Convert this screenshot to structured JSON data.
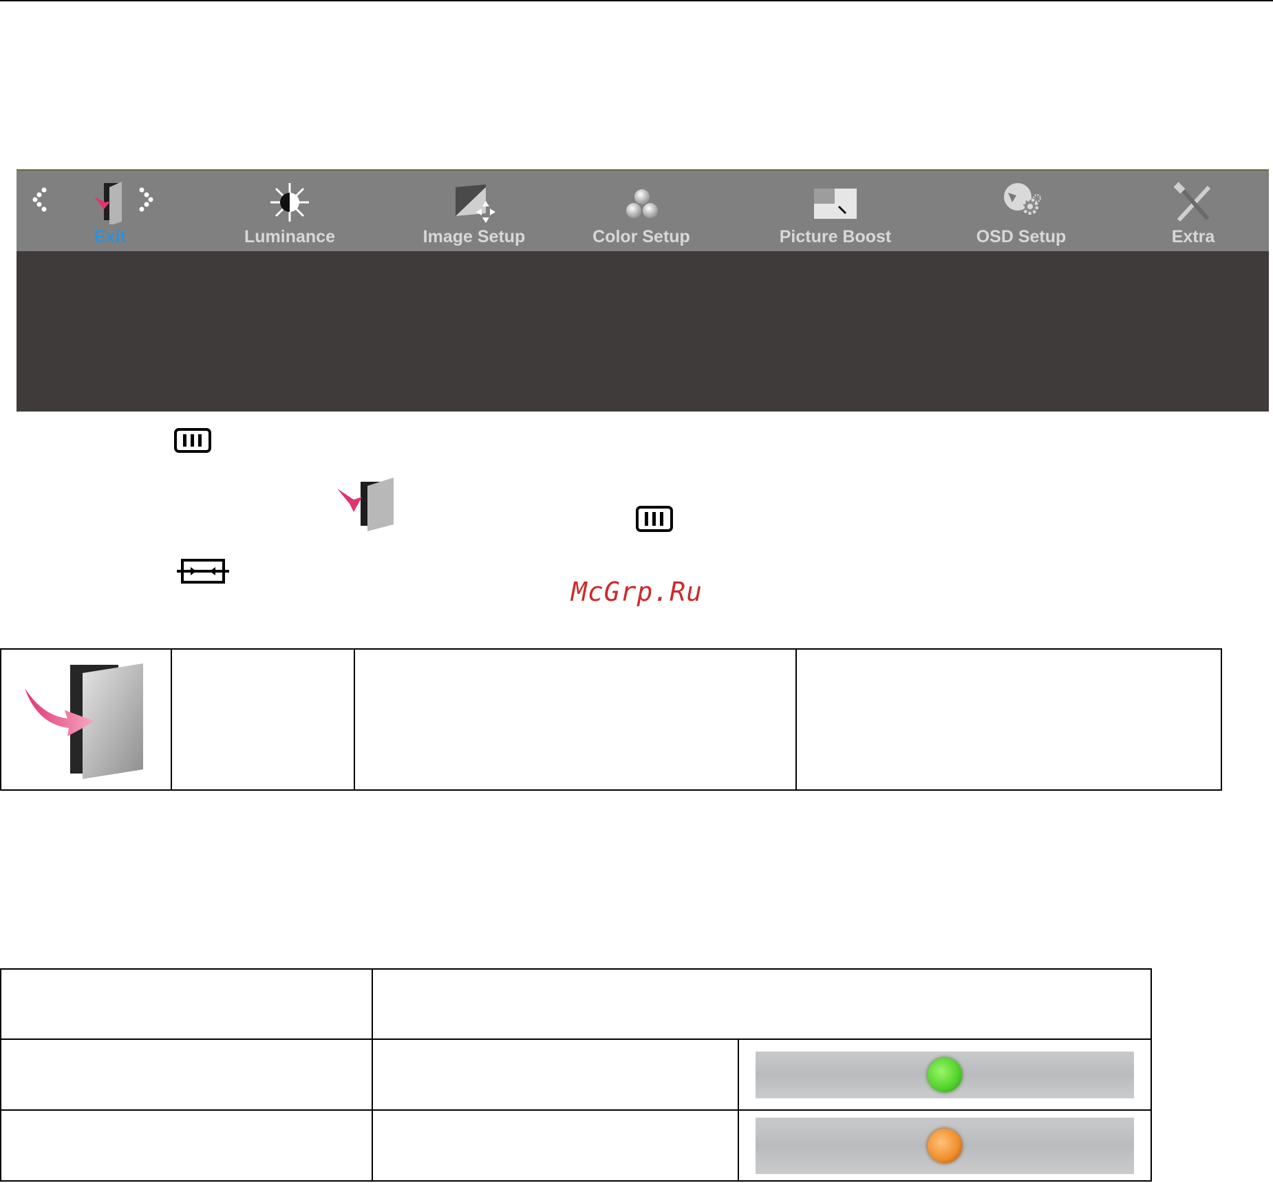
{
  "osd": {
    "tabs": [
      {
        "label": "Exit",
        "icon": "exit-door-icon",
        "active": true
      },
      {
        "label": "Luminance",
        "icon": "sun-icon"
      },
      {
        "label": "Image Setup",
        "icon": "image-setup-icon"
      },
      {
        "label": "Color Setup",
        "icon": "color-circles-icon"
      },
      {
        "label": "Picture Boost",
        "icon": "picture-boost-icon"
      },
      {
        "label": "OSD Setup",
        "icon": "osd-setup-icon"
      },
      {
        "label": "Extra",
        "icon": "tools-icon"
      }
    ],
    "active_color": "#2f8fd8",
    "bar_color": "#808080",
    "body_color": "#3f3b3a"
  },
  "watermark": "McGrp.Ru",
  "led": {
    "green": "#4fd22a",
    "orange": "#f08c28"
  }
}
